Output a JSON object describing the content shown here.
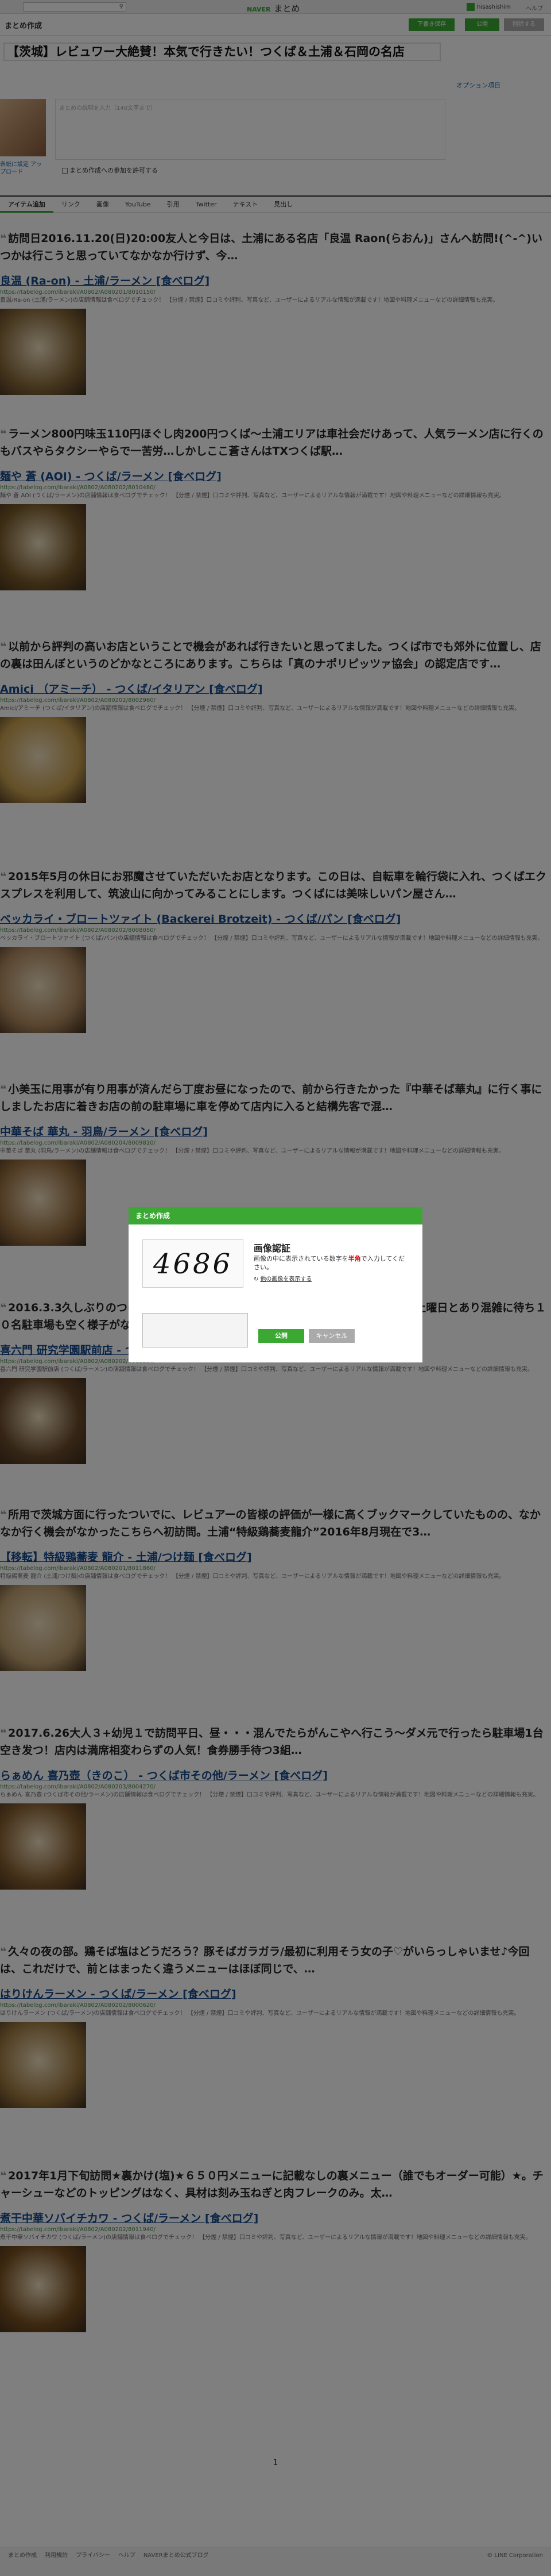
{
  "topbar": {
    "search_placeholder": "",
    "logo_sub": "NAVER",
    "logo": "まとめ",
    "user": "hisashishim",
    "help": "ヘルプ"
  },
  "header": {
    "title": "まとめ作成",
    "draft_label": "下書き保存",
    "publish_label": "公開",
    "delete_label": "削除する"
  },
  "editor": {
    "title_value": "【茨城】レビュワー大絶賛！本気で行きたい！つくば＆土浦＆石岡の名店",
    "option_link": "オプション項目",
    "cover_label": "表紙に設定 アップロード",
    "description_placeholder": "まとめの説明を入力（140文字まで）",
    "reuse_label": "まとめ作成への参加を許可する"
  },
  "tabs": [
    "アイテム追加",
    "リンク",
    "画像",
    "YouTube",
    "引用",
    "Twitter",
    "テキスト",
    "見出し"
  ],
  "items": [
    {
      "comment": "訪問日2016.11.20(日)20:00友人と今日は、土浦にある名店「良温 Raon(らおん)」さんへ訪問!(^-^)いつかは行こうと思っていてなかなか行けず、今…",
      "link": "良温 (Ra-on) - 土浦/ラーメン [食べログ]",
      "url": "https://tabelog.com/ibaraki/A0802/A080201/8010150/",
      "desc": "良温/Ra-on (土浦/ラーメン)の店舗情報は食べログでチェック！ 【分煙 / 禁煙】口コミや評判、写真など、ユーザーによるリアルな情報が満載です！地図や料理メニューなどの詳細情報も充実。",
      "thumb": "#8a6a3a"
    },
    {
      "comment": "ラーメン800円味玉110円ほぐし肉200円つくば〜土浦エリアは車社会だけあって、人気ラーメン店に行くのもバスやらタクシーやらで一苦労…しかしここ蒼さんはTXつくば駅…",
      "link": "麺や 蒼 (AOI) - つくば/ラーメン [食べログ]",
      "url": "https://tabelog.com/ibaraki/A0802/A080202/8010480/",
      "desc": "麺や 蒼 AOI (つくば/ラーメン)の店舗情報は食べログでチェック！ 【分煙 / 禁煙】口コミや評判、写真など、ユーザーによるリアルな情報が満載です！地図や料理メニューなどの詳細情報も充実。",
      "thumb": "#7a5a2a"
    },
    {
      "comment": "以前から評判の高いお店ということで機会があれば行きたいと思ってました。つくば市でも郊外に位置し、店の裏は田んぼというのどかなところにあります。こちらは「真のナポリピッツァ協会」の認定店です…",
      "link": "Amici （アミーチ） - つくば/イタリアン [食べログ]",
      "url": "https://tabelog.com/ibaraki/A0802/A080202/8002960/",
      "desc": "Amici/アミーチ (つくば/イタリアン)の店舗情報は食べログでチェック！ 【分煙 / 禁煙】口コミや評判、写真など、ユーザーによるリアルな情報が満載です！地図や料理メニューなどの詳細情報も充実。",
      "thumb": "#c8a050"
    },
    {
      "comment": "2015年5月の休日にお邪魔させていただいたお店となります。この日は、自転車を輪行袋に入れ、つくばエクスプレスを利用して、筑波山に向かってみることにします。つくばには美味しいパン屋さん…",
      "link": "ベッカライ・ブロートツァイト (Backerei Brotzeit) - つくば/パン [食べログ]",
      "url": "https://tabelog.com/ibaraki/A0802/A080202/8008050/",
      "desc": "ベッカライ・ブロートツァイト (つくば/パン)の店舗情報は食べログでチェック！ 【分煙 / 禁煙】口コミや評判、写真など、ユーザーによるリアルな情報が満載です！地図や料理メニューなどの詳細情報も充実。",
      "thumb": "#b08a60"
    },
    {
      "comment": "小美玉に用事が有り用事が済んだら丁度お昼になったので、前から行きたかった『中華そば華丸』に行く事にしましたお店に着きお店の前の駐車場に車を停めて店内に入ると結構先客で混…",
      "link": "中華そば 華丸 - 羽鳥/ラーメン [食べログ]",
      "url": "https://tabelog.com/ibaraki/A0802/A080204/8009810/",
      "desc": "中華そば 華丸 (羽鳥/ラーメン)の店舗情報は食べログでチェック！ 【分煙 / 禁煙】口コミや評判、写真など、ユーザーによるリアルな情報が満載です！地図や料理メニューなどの詳細情報も充実。",
      "thumb": "#9a7040"
    },
    {
      "comment": "2016.3.3久しぶりのつけ麺食べに行きました。店内にはいると10人前後の訪問。土曜日とあり混雑に待ち１０名駐車場も空く様子がないので、ここでは初めてCP利用（家前に付き沢山…",
      "link": "喜六門 研究学園駅前店 - つくば/ラーメン [食べログ]",
      "url": "https://tabelog.com/ibaraki/A0802/A080202/8012280/",
      "desc": "喜六門 研究学園駅前店 (つくば/ラーメン)の店舗情報は食べログでチェック！ 【分煙 / 禁煙】口コミや評判、写真など、ユーザーによるリアルな情報が満載です！地図や料理メニューなどの詳細情報も充実。",
      "thumb": "#6a4a2a"
    },
    {
      "comment": "所用で茨城方面に行ったついでに、レビュアーの皆様の評価が一様に高くブックマークしていたものの、なかなか行く機会がなかったこちらへ初訪問。土浦“特級鶏蕎麦龍介”2016年8月現在で3…",
      "link": "【移転】特級鶏蕎麦 龍介 - 土浦/つけ麺 [食べログ]",
      "url": "https://tabelog.com/ibaraki/A0802/A080201/8011860/",
      "desc": "特級鶏蕎麦 龍介 (土浦/つけ麺)の店舗情報は食べログでチェック！ 【分煙 / 禁煙】口コミや評判、写真など、ユーザーによるリアルな情報が満載です！地図や料理メニューなどの詳細情報も充実。",
      "thumb": "#c0a070"
    },
    {
      "comment": "2017.6.26大人３+幼児１で訪問平日、昼・・・混んでたらがんこやへ行こう〜ダメ元で行ったら駐車場1台空き发つ！店内は満席相変わらずの人気！食券勝手待つ3組…",
      "link": "らぁめん 喜乃壺（きのこ） - つくば市その他/ラーメン [食べログ]",
      "url": "https://tabelog.com/ibaraki/A0802/A080203/8004270/",
      "desc": "らぁめん 喜乃壺 (つくば市その他/ラーメン)の店舗情報は食べログでチェック！ 【分煙 / 禁煙】口コミや評判、写真など、ユーザーによるリアルな情報が満載です！地図や料理メニューなどの詳細情報も充実。",
      "thumb": "#8a6030"
    },
    {
      "comment": "久々の夜の部。鶏そば塩はどうだろう？豚そばガラガラ/最初に利用そう女の子♡がいらっしゃいませ♪今回は、これだけで、前とはまったく違うメニューはほぼ同じで、…",
      "link": "はりけんラーメン - つくば/ラーメン [食べログ]",
      "url": "https://tabelog.com/ibaraki/A0802/A080202/8000620/",
      "desc": "はりけんラーメン (つくば/ラーメン)の店舗情報は食べログでチェック！ 【分煙 / 禁煙】口コミや評判、写真など、ユーザーによるリアルな情報が満載です！地図や料理メニューなどの詳細情報も充実。",
      "thumb": "#a07a40"
    },
    {
      "comment": "2017年1月下旬訪問★裏かけ(塩)★６５０円メニューに記載なしの裏メニュー（誰でもオーダー可能）★。チャーシューなどのトッピングはなく、具材は刻み玉ねぎと肉フレークのみ。太…",
      "link": "煮干中華ソバイチカワ - つくば/ラーメン [食べログ]",
      "url": "https://tabelog.com/ibaraki/A0802/A080202/8011940/",
      "desc": "煮干中華ソバイチカワ (つくば/ラーメン)の店舗情報は食べログでチェック！ 【分煙 / 禁煙】口コミや評判、写真など、ユーザーによるリアルな情報が満載です！地図や料理メニューなどの詳細情報も充実。",
      "thumb": "#7a5020"
    }
  ],
  "pagination": {
    "current": "1"
  },
  "footer": {
    "links": [
      "まとめ作成",
      "利用規約",
      "プライバシー",
      "ヘルプ",
      "NAVERまとめ公式ブログ"
    ],
    "copyright": "© LINE Corporation"
  },
  "dialog": {
    "header": "まとめ作成",
    "captcha_text": "4686",
    "title": "画像認証",
    "instruction_pre": "画像の中に表示されている数字を",
    "instruction_red": "半角",
    "instruction_post": "で入力してください。",
    "refresh_label": "他の画像を表示する",
    "input_value": "",
    "ok_label": "公開",
    "cancel_label": "キャンセル"
  }
}
